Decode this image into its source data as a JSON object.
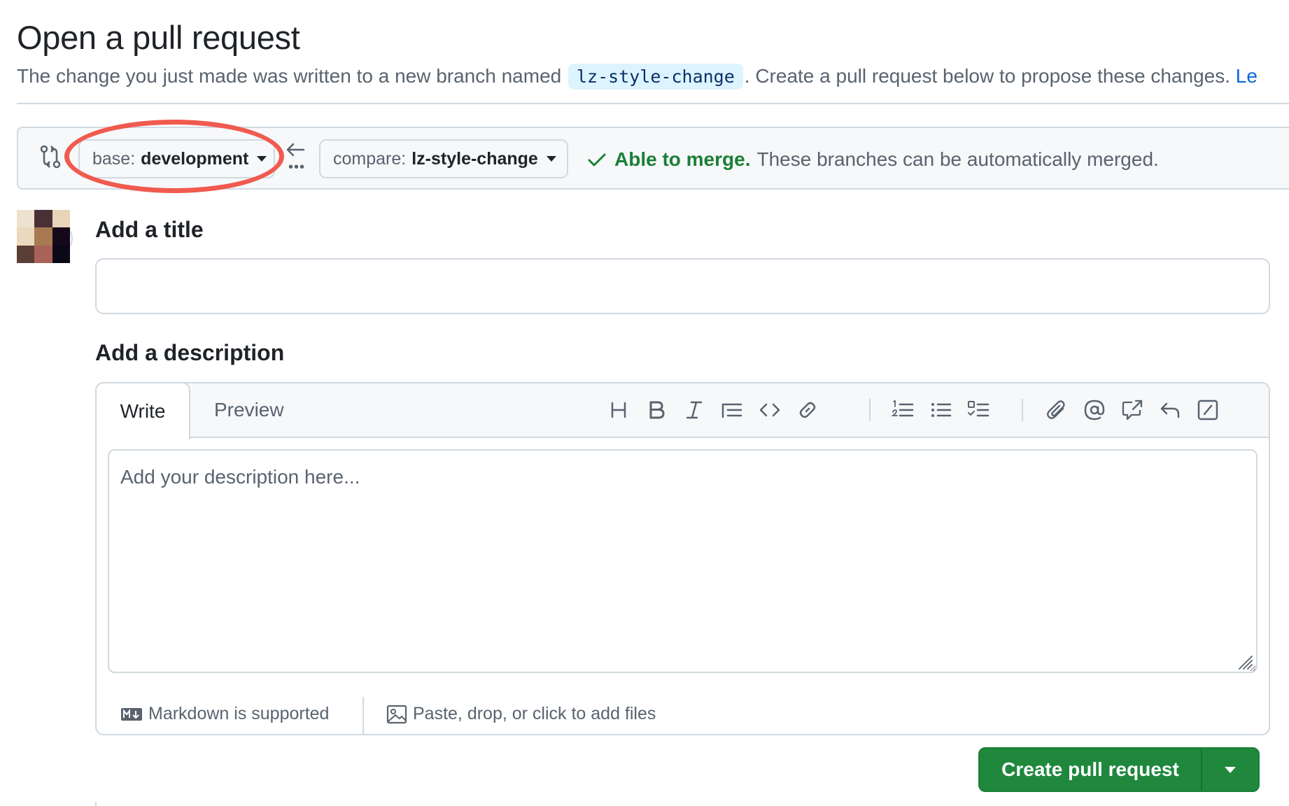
{
  "header": {
    "title": "Open a pull request",
    "subtitle_before": "The change you just made was written to a new branch named",
    "branch_name": "lz-style-change",
    "subtitle_after": ". Create a pull request below to propose these changes.",
    "learn_link": "Le"
  },
  "compare_bar": {
    "base_prefix": "base:",
    "base_branch": "development",
    "compare_prefix": "compare:",
    "compare_branch": "lz-style-change",
    "merge_status": "Able to merge.",
    "merge_message": "These branches can be automatically merged.",
    "status_color": "#1a7f37",
    "highlight_color": "#f05a4f"
  },
  "form": {
    "title_label": "Add a title",
    "title_value": "",
    "description_label": "Add a description",
    "tabs": [
      "Write",
      "Preview"
    ],
    "active_tab": "Write",
    "description_placeholder": "Add your description here...",
    "toolbar_icons": [
      "heading-icon",
      "bold-icon",
      "italic-icon",
      "quote-icon",
      "code-icon",
      "link-icon",
      "numbered-list-icon",
      "bulleted-list-icon",
      "task-list-icon",
      "attach-icon",
      "mention-icon",
      "cross-reference-icon",
      "reply-icon",
      "slash-command-icon"
    ],
    "markdown_note": "Markdown is supported",
    "attach_note": "Paste, drop, or click to add files"
  },
  "actions": {
    "create_label": "Create pull request",
    "button_color": "#1f883d"
  }
}
